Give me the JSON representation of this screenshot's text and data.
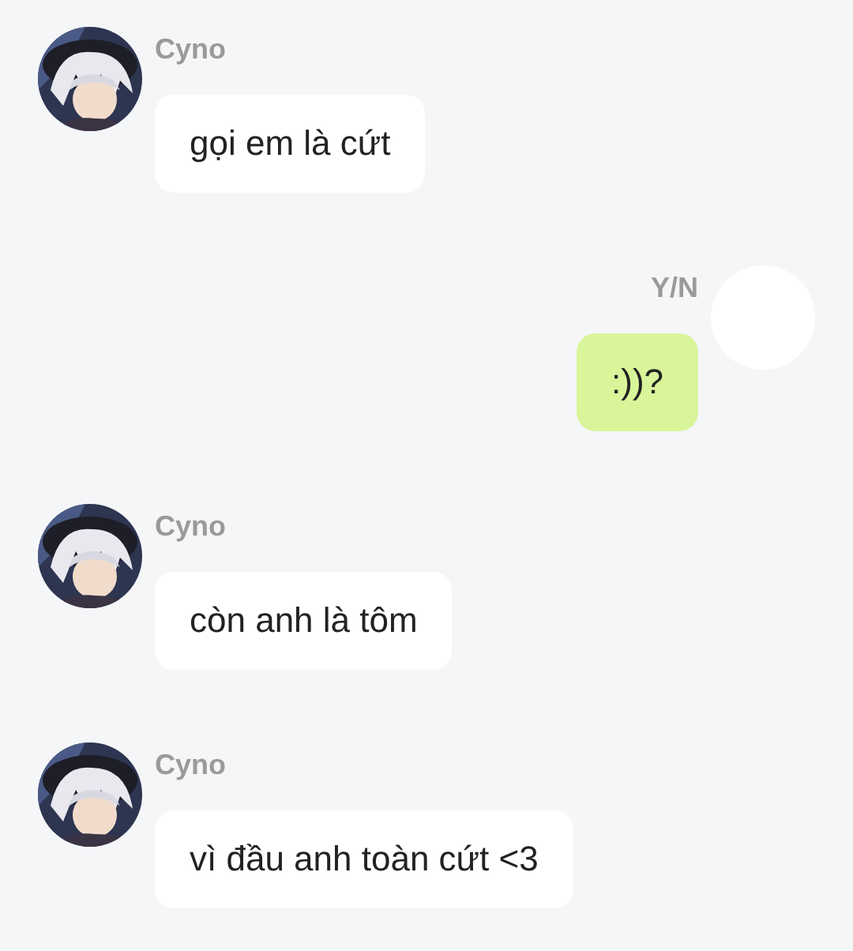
{
  "messages": [
    {
      "sender": "Cyno",
      "kind": "received",
      "text": "gọi em là cứt"
    },
    {
      "sender": "Y/N",
      "kind": "sent",
      "avatar": {
        "kind": "blank"
      },
      "text": ":))?"
    },
    {
      "sender": "Cyno",
      "kind": "received",
      "text": "còn anh là tôm"
    },
    {
      "sender": "Cyno",
      "kind": "received",
      "text": "vì đầu anh toàn cứt <3"
    }
  ]
}
